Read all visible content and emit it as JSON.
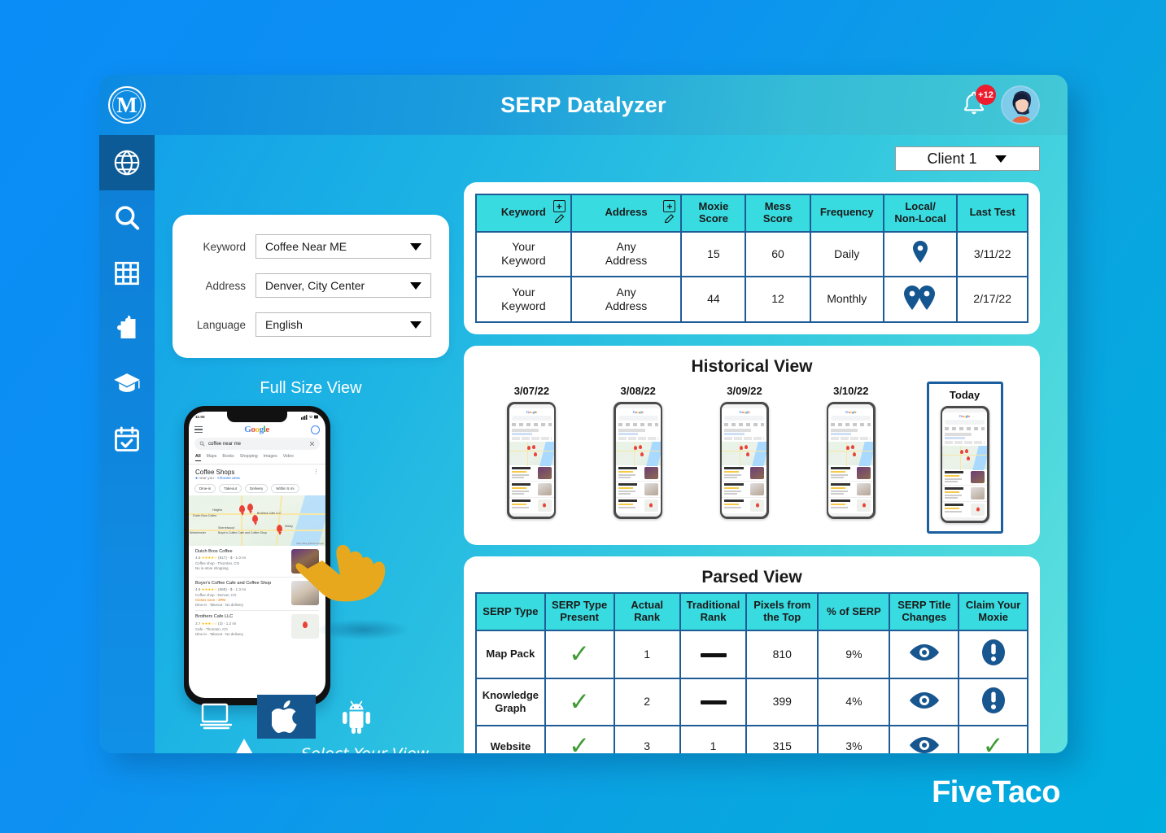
{
  "app": {
    "title": "SERP Datalyzer",
    "brand_mark": "M",
    "notification_badge": "+12",
    "footer_logo": "FiveTaco",
    "accent_cyan": "#38dbe0",
    "accent_blue": "#1d5c96",
    "green": "#3f9b35",
    "badge_red": "#ed1c2e"
  },
  "sidebar": {
    "items": [
      {
        "name": "globe-icon",
        "label": "Global",
        "active": true
      },
      {
        "name": "search-icon",
        "label": "Search",
        "active": false
      },
      {
        "name": "grid-icon",
        "label": "Grid",
        "active": false
      },
      {
        "name": "puzzle-icon",
        "label": "Integrations",
        "active": false
      },
      {
        "name": "graduation-cap-icon",
        "label": "Learn",
        "active": false
      },
      {
        "name": "calendar-check-icon",
        "label": "Schedule",
        "active": false
      }
    ]
  },
  "filters": {
    "rows": [
      {
        "label": "Keyword",
        "value": "Coffee Near ME"
      },
      {
        "label": "Address",
        "value": "Denver, City Center"
      },
      {
        "label": "Language",
        "value": "English"
      }
    ]
  },
  "client_selector": {
    "value": "Client 1"
  },
  "keyword_table": {
    "headers": [
      "Keyword",
      "Address",
      "Moxie Score",
      "Mess Score",
      "Frequency",
      "Local/ Non-Local",
      "Last Test"
    ],
    "headers_multiline": [
      [
        "Keyword"
      ],
      [
        "Address"
      ],
      [
        "Moxie",
        "Score"
      ],
      [
        "Mess",
        "Score"
      ],
      [
        "Frequency"
      ],
      [
        "Local/",
        "Non-Local"
      ],
      [
        "Last Test"
      ]
    ],
    "rows": [
      {
        "keyword": [
          "Your",
          "Keyword"
        ],
        "address": [
          "Any",
          "Address"
        ],
        "moxie_score": "15",
        "mess_score": "60",
        "frequency": "Daily",
        "local_icon": "single-map-pin-icon",
        "last_test": "3/11/22"
      },
      {
        "keyword": [
          "Your",
          "Keyword"
        ],
        "address": [
          "Any",
          "Address"
        ],
        "moxie_score": "44",
        "mess_score": "12",
        "frequency": "Monthly",
        "local_icon": "double-map-pin-icon",
        "last_test": "2/17/22"
      }
    ]
  },
  "full_size_view": {
    "label": "Full Size View",
    "phone": {
      "status_time": "11:00",
      "search_query": "coffee near me",
      "tabs": [
        "All",
        "Maps",
        "Books",
        "Shopping",
        "Images",
        "Video"
      ],
      "section_title": "Coffee Shops",
      "near_you": "near you -",
      "choose_area": "Choose area",
      "chips": [
        "Dine-in",
        "Takeout",
        "Delivery",
        "Within 5 mi"
      ],
      "map_labels": [
        "Heights",
        "Dutch Bros Coffee",
        "Brothers Cafe LLC",
        "Sherrelwood",
        "Welby",
        "Westminster",
        "Boyer's Coffee Cafe and Coffee Shop",
        "Map data @2022 Google"
      ],
      "listings": [
        {
          "name": "Dutch Bros Coffee",
          "rating": "4.5",
          "stars": "★★★★☆",
          "reviews": "(817) - $ - 1.0 mi",
          "meta": "Coffee shop - Thornton, CO",
          "meta2": "No in-store shopping",
          "closes": ""
        },
        {
          "name": "Boyer's Coffee Cafe and Coffee Shop",
          "rating": "4.6",
          "stars": "★★★★☆",
          "reviews": "(658) - $ - 1.3 mi",
          "meta": "Coffee shop - Denver, CO",
          "closes": "Closes soon - 3PM",
          "meta2": "Dine-in - Takeout - No delivery"
        },
        {
          "name": "Brothers Cafe LLC",
          "rating": "3.7",
          "stars": "★★★☆☆",
          "reviews": "(3) - 1.2 mi",
          "meta": "Cafe - Thornton, CO",
          "meta2": "Dine-in - Takeout - No delivery",
          "closes": ""
        }
      ]
    }
  },
  "device_selector": {
    "hint": "Select Your View",
    "options": [
      {
        "name": "desktop-icon",
        "label": "Desktop",
        "selected": false
      },
      {
        "name": "apple-icon",
        "label": "iOS",
        "selected": true
      },
      {
        "name": "android-icon",
        "label": "Android",
        "selected": false
      }
    ]
  },
  "historical_view": {
    "title": "Historical View",
    "snapshots": [
      {
        "date": "3/07/22",
        "is_today": false
      },
      {
        "date": "3/08/22",
        "is_today": false
      },
      {
        "date": "3/09/22",
        "is_today": false
      },
      {
        "date": "3/10/22",
        "is_today": false
      },
      {
        "date": "Today",
        "is_today": true
      }
    ]
  },
  "parsed_view": {
    "title": "Parsed View",
    "headers_multiline": [
      [
        "SERP Type"
      ],
      [
        "SERP Type",
        "Present"
      ],
      [
        "Actual",
        "Rank"
      ],
      [
        "Traditional",
        "Rank"
      ],
      [
        "Pixels from",
        "the Top"
      ],
      [
        "% of SERP"
      ],
      [
        "SERP Title",
        "Changes"
      ],
      [
        "Claim Your",
        "Moxie"
      ]
    ],
    "rows": [
      {
        "serp_type": [
          "Map Pack"
        ],
        "serp_type_present": "check",
        "actual_rank": "1",
        "traditional_rank": "dash",
        "pixels_from_top": "810",
        "percent_of_serp": "9%",
        "serp_title_changes": "eye-icon",
        "claim_your_moxie": "exclamation-icon"
      },
      {
        "serp_type": [
          "Knowledge",
          "Graph"
        ],
        "serp_type_present": "check",
        "actual_rank": "2",
        "traditional_rank": "dash",
        "pixels_from_top": "399",
        "percent_of_serp": "4%",
        "serp_title_changes": "eye-icon",
        "claim_your_moxie": "exclamation-icon"
      },
      {
        "serp_type": [
          "Website"
        ],
        "serp_type_present": "check",
        "actual_rank": "3",
        "traditional_rank": "1",
        "pixels_from_top": "315",
        "percent_of_serp": "3%",
        "serp_title_changes": "eye-icon",
        "claim_your_moxie": "check"
      }
    ]
  }
}
